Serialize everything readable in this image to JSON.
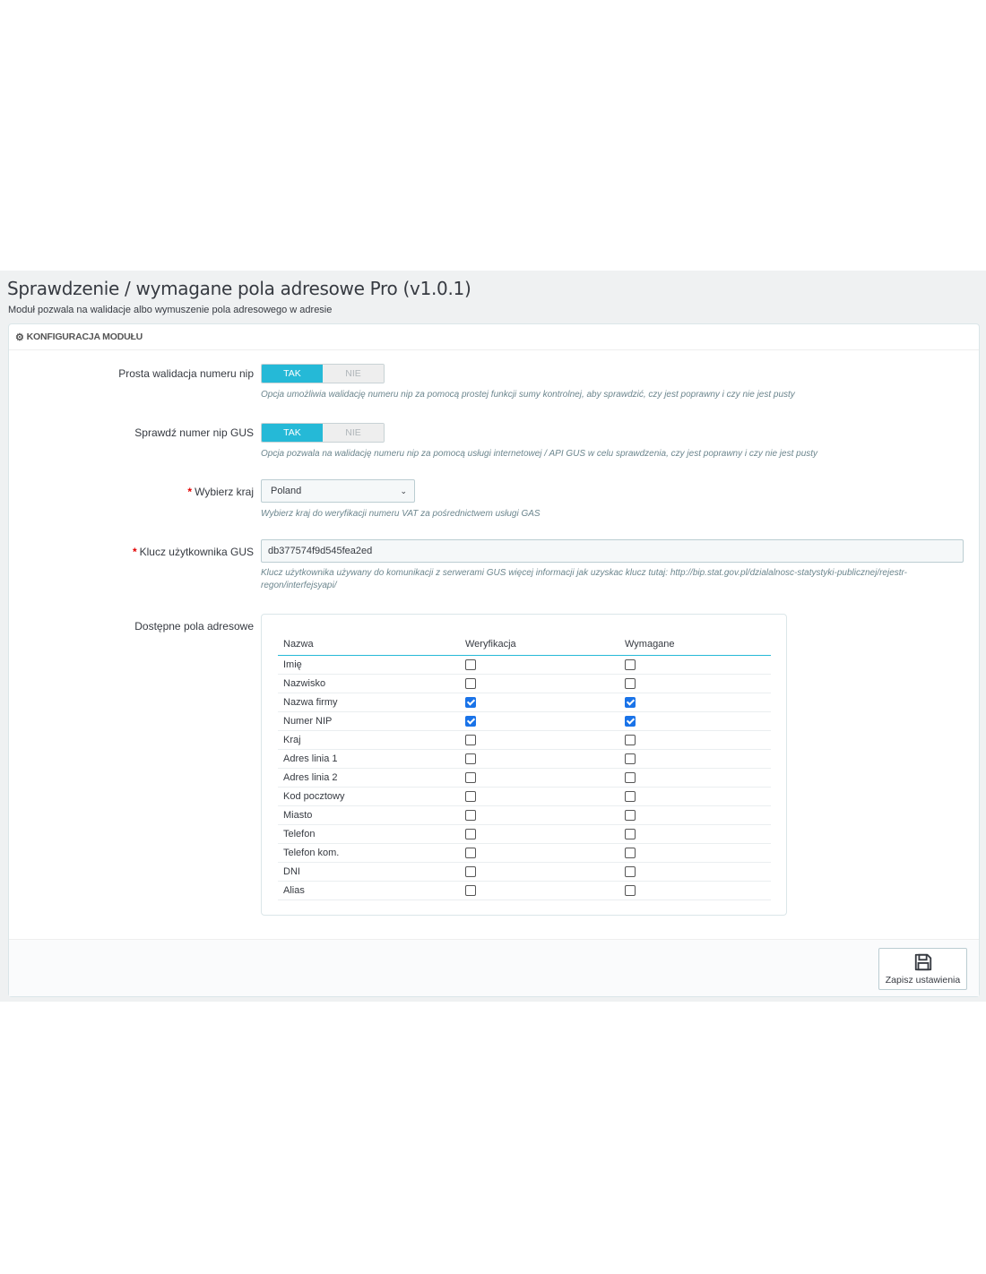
{
  "header": {
    "title": "Sprawdzenie / wymagane pola adresowe Pro (v1.0.1)",
    "description": "Moduł pozwala na walidacje albo wymuszenie pola adresowego w adresie"
  },
  "panel": {
    "heading": "KONFIGURACJA MODUŁU",
    "icon": "cogs-icon"
  },
  "form": {
    "nip_validation": {
      "label": "Prosta walidacja numeru nip",
      "yes": "TAK",
      "no": "NIE",
      "value": "TAK",
      "help": "Opcja umożliwia walidację numeru nip za pomocą prostej funkcji sumy kontrolnej, aby sprawdzić, czy jest poprawny i czy nie jest pusty"
    },
    "gus_check": {
      "label": "Sprawdź numer nip GUS",
      "yes": "TAK",
      "no": "NIE",
      "value": "TAK",
      "help": "Opcja pozwala na walidację numeru nip za pomocą usługi internetowej / API GUS w celu sprawdzenia, czy jest poprawny i czy nie jest pusty"
    },
    "country": {
      "label": "Wybierz kraj",
      "required_mark": "*",
      "value": "Poland",
      "help": "Wybierz kraj do weryfikacji numeru VAT za pośrednictwem usługi GAS"
    },
    "gus_key": {
      "label": "Klucz użytkownika GUS",
      "required_mark": "*",
      "value": "db377574f9d545fea2ed",
      "help": "Klucz użytkownika używany do komunikacji z serwerami GUS więcej informacji jak uzyskac klucz tutaj: http://bip.stat.gov.pl/dzialalnosc-statystyki-publicznej/rejestr-regon/interfejsyapi/"
    },
    "fields": {
      "label": "Dostępne pola adresowe",
      "columns": [
        "Nazwa",
        "Weryfikacja",
        "Wymagane"
      ],
      "rows": [
        {
          "name": "Imię",
          "verify": false,
          "required": false
        },
        {
          "name": "Nazwisko",
          "verify": false,
          "required": false
        },
        {
          "name": "Nazwa firmy",
          "verify": true,
          "required": true
        },
        {
          "name": "Numer NIP",
          "verify": true,
          "required": true
        },
        {
          "name": "Kraj",
          "verify": false,
          "required": false
        },
        {
          "name": "Adres linia 1",
          "verify": false,
          "required": false
        },
        {
          "name": "Adres linia 2",
          "verify": false,
          "required": false
        },
        {
          "name": "Kod pocztowy",
          "verify": false,
          "required": false
        },
        {
          "name": "Miasto",
          "verify": false,
          "required": false
        },
        {
          "name": "Telefon",
          "verify": false,
          "required": false
        },
        {
          "name": "Telefon kom.",
          "verify": false,
          "required": false
        },
        {
          "name": "DNI",
          "verify": false,
          "required": false
        },
        {
          "name": "Alias",
          "verify": false,
          "required": false
        }
      ]
    }
  },
  "footer": {
    "save_label": "Zapisz ustawienia",
    "save_icon": "floppy-disk-icon"
  },
  "colors": {
    "accent": "#25b9d7",
    "checkbox_checked": "#1a73e8",
    "required": "#e30000"
  }
}
